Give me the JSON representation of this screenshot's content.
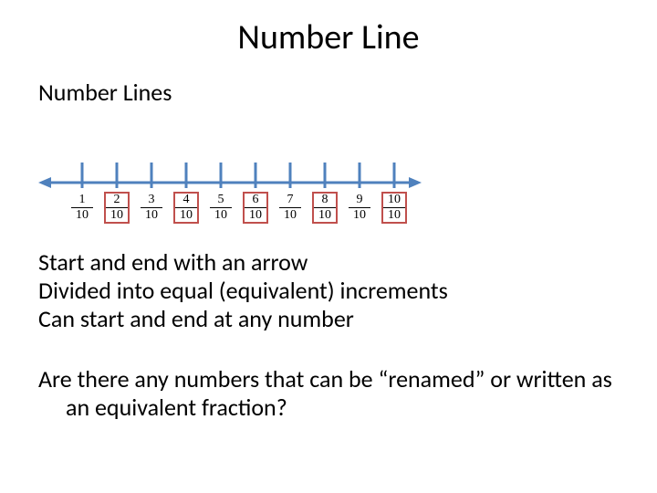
{
  "title": "Number Line",
  "subtitle": "Number Lines",
  "numberline": {
    "denominator": "10",
    "ticks": [
      {
        "num": "1",
        "den": "10",
        "boxed": false
      },
      {
        "num": "2",
        "den": "10",
        "boxed": true
      },
      {
        "num": "3",
        "den": "10",
        "boxed": false
      },
      {
        "num": "4",
        "den": "10",
        "boxed": true
      },
      {
        "num": "5",
        "den": "10",
        "boxed": false
      },
      {
        "num": "6",
        "den": "10",
        "boxed": true
      },
      {
        "num": "7",
        "den": "10",
        "boxed": false
      },
      {
        "num": "8",
        "den": "10",
        "boxed": true
      },
      {
        "num": "9",
        "den": "10",
        "boxed": false
      },
      {
        "num": "10",
        "den": "10",
        "boxed": true
      }
    ],
    "colors": {
      "line": "#4f81bd",
      "box": "#c0504d"
    }
  },
  "bullets": {
    "b1": "Start and end with an arrow",
    "b2": "Divided into equal (equivalent) increments",
    "b3": "Can start and end at any number"
  },
  "question": "Are there any numbers that can be “renamed” or written as an equivalent fraction?"
}
